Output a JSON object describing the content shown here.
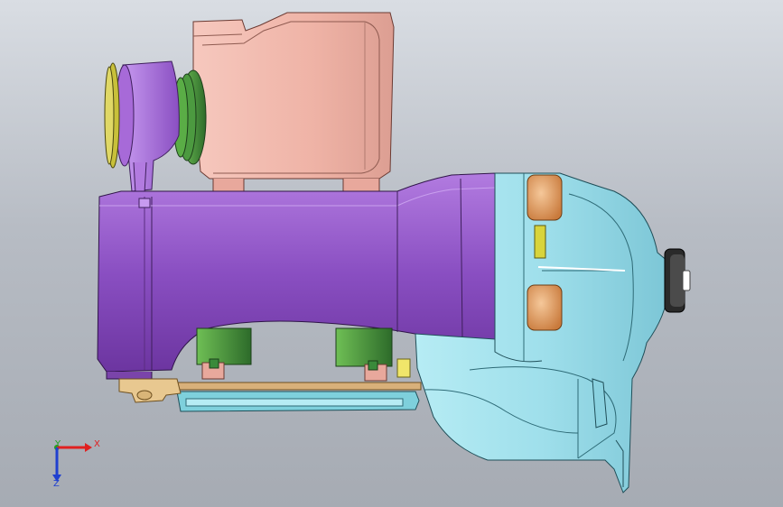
{
  "viewport": {
    "background_top": "#d9dde3",
    "background_bottom": "#a6abb3"
  },
  "triad": {
    "x_label": "X",
    "y_label": "Y",
    "z_label": "Z",
    "x_color": "#e02020",
    "y_color": "#20a020",
    "z_color": "#2040d0"
  },
  "parts": {
    "housing_color": "#9455c8",
    "tank_color": "#f0b4a8",
    "casing_color": "#9fe0ec",
    "cap_color": "#e09a5e",
    "bracket_color": "#3a8a3a",
    "seal_color": "#b8b830",
    "tray_color": "#7ed0dc",
    "mount_color": "#e8c890"
  }
}
